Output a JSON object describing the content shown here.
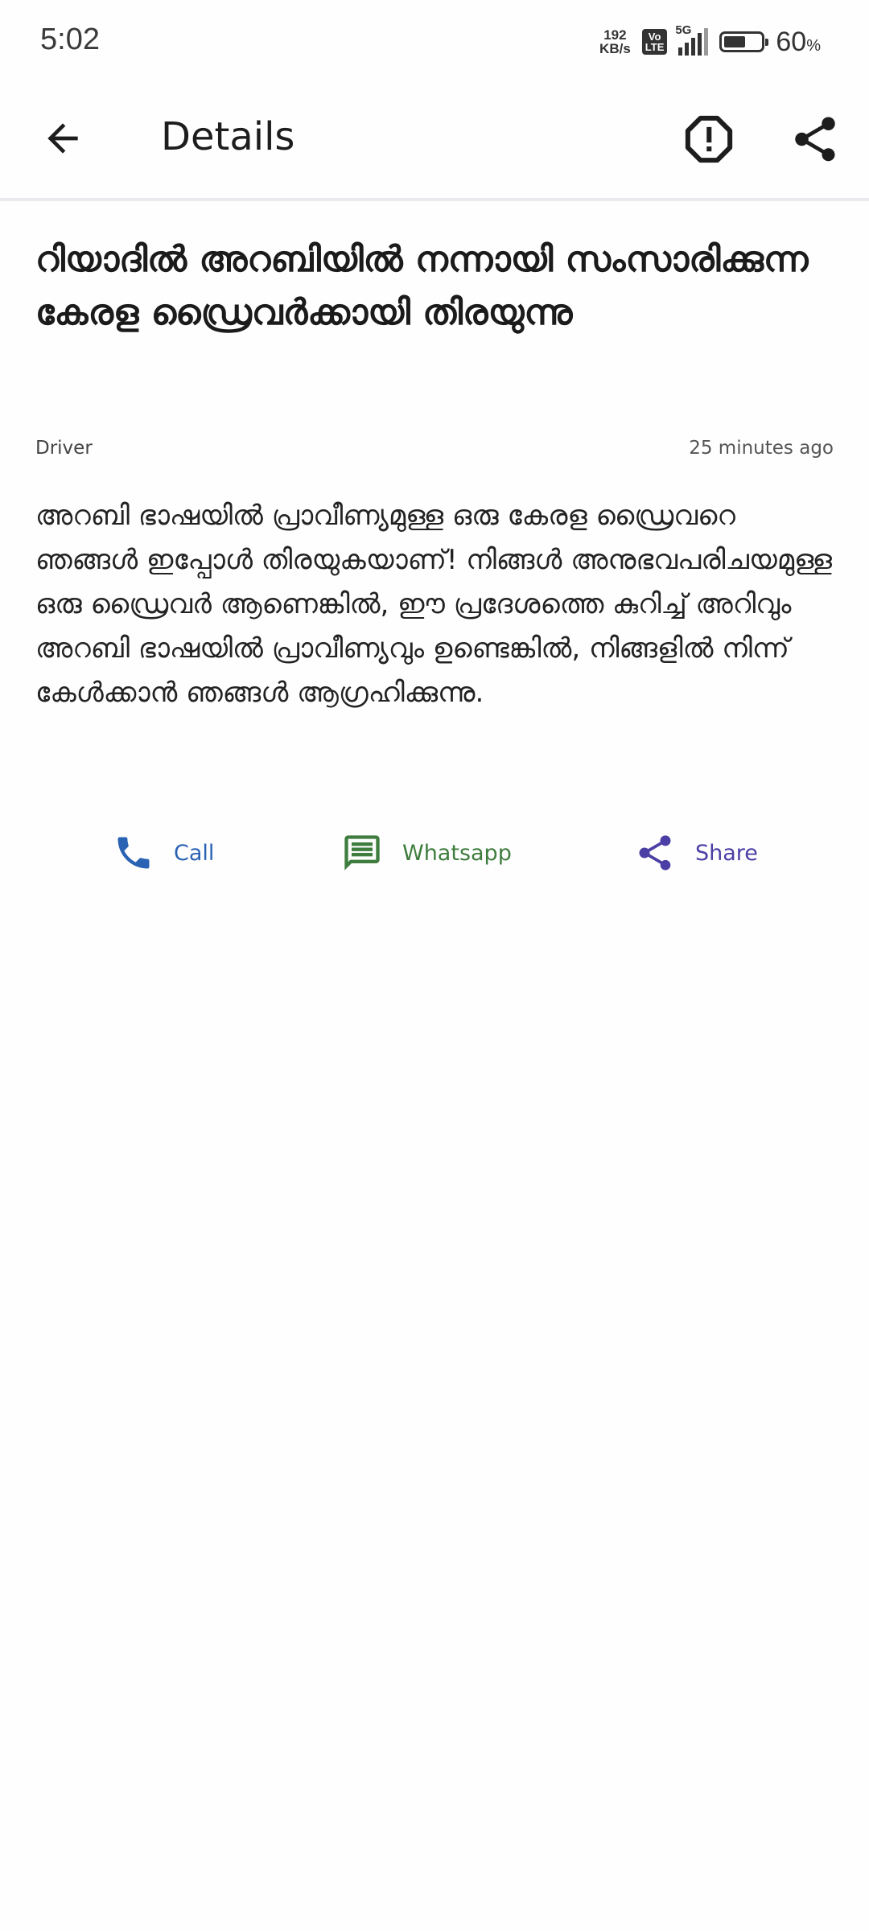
{
  "status_bar": {
    "time": "5:02",
    "net_speed_value": "192",
    "net_speed_unit": "KB/s",
    "volte_top": "Vo",
    "volte_bottom": "LTE",
    "network": "5G",
    "battery_percent": "60",
    "battery_unit": "%",
    "battery_level": 0.6
  },
  "app_bar": {
    "title": "Details",
    "back_icon": "arrow-left-icon",
    "report_icon": "alert-octagon-icon",
    "share_icon": "share-icon"
  },
  "post": {
    "title": "റിയാദിൽ അറബിയിൽ നന്നായി സംസാരിക്കുന്ന കേരള ഡ്രൈവർക്കായി തിരയുന്നു",
    "category": "Driver",
    "time_ago": "25 minutes ago",
    "body": "അറബി ഭാഷയിൽ പ്രാവീണ്യമുള്ള ഒരു കേരള ഡ്രൈവറെ ഞങ്ങൾ ഇപ്പോൾ തിരയുകയാണ്! നിങ്ങൾ അനുഭവപരിചയമുള്ള ഒരു ഡ്രൈവർ ആണെങ്കിൽ, ഈ പ്രദേശത്തെ കുറിച്ച് അറിവും അറബി ഭാഷയിൽ പ്രാവീണ്യവും ഉണ്ടെങ്കിൽ, നിങ്ങളിൽ നിന്ന് കേൾക്കാൻ ഞങ്ങൾ ആഗ്രഹിക്കുന്നു."
  },
  "actions": {
    "call": {
      "label": "Call",
      "icon": "phone-icon",
      "color": "#2a63b3"
    },
    "whatsapp": {
      "label": "Whatsapp",
      "icon": "message-icon",
      "color": "#3f7d3e"
    },
    "share": {
      "label": "Share",
      "icon": "share-icon",
      "color": "#4b3fa5"
    }
  }
}
